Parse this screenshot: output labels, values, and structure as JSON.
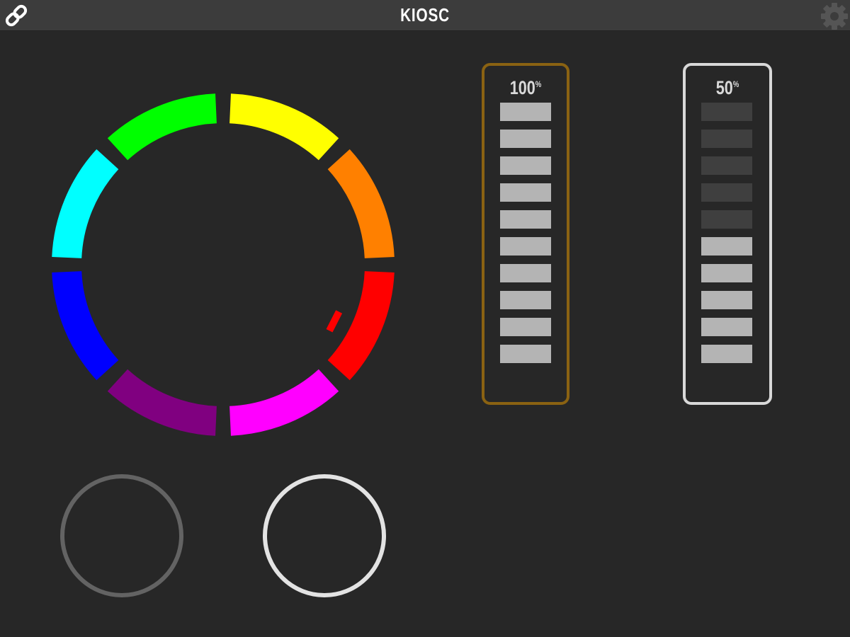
{
  "app": {
    "title": "KIOSC"
  },
  "toolbar": {
    "link_icon": "link-icon",
    "settings_icon": "gear-icon"
  },
  "color_wheel": {
    "segments": [
      {
        "name": "green",
        "color": "#00ff00"
      },
      {
        "name": "yellow",
        "color": "#ffff00"
      },
      {
        "name": "orange",
        "color": "#ff8000"
      },
      {
        "name": "red",
        "color": "#ff0000"
      },
      {
        "name": "magenta",
        "color": "#ff00ff"
      },
      {
        "name": "purple",
        "color": "#800080"
      },
      {
        "name": "blue",
        "color": "#0000ff"
      },
      {
        "name": "cyan",
        "color": "#00ffff"
      }
    ],
    "indicator_color": "#ff0000"
  },
  "faders": [
    {
      "value_label": "100",
      "unit": "%",
      "level": 1.0,
      "active_bars": 10,
      "total_bars": 10,
      "border_color": "#8a6212"
    },
    {
      "value_label": "50",
      "unit": "%",
      "level": 0.5,
      "active_bars": 5,
      "total_bars": 10,
      "border_color": "#d8d8d8"
    }
  ],
  "buttons": [
    {
      "state": "off",
      "border_color": "#636363"
    },
    {
      "state": "on",
      "border_color": "#e3e3e3"
    }
  ]
}
